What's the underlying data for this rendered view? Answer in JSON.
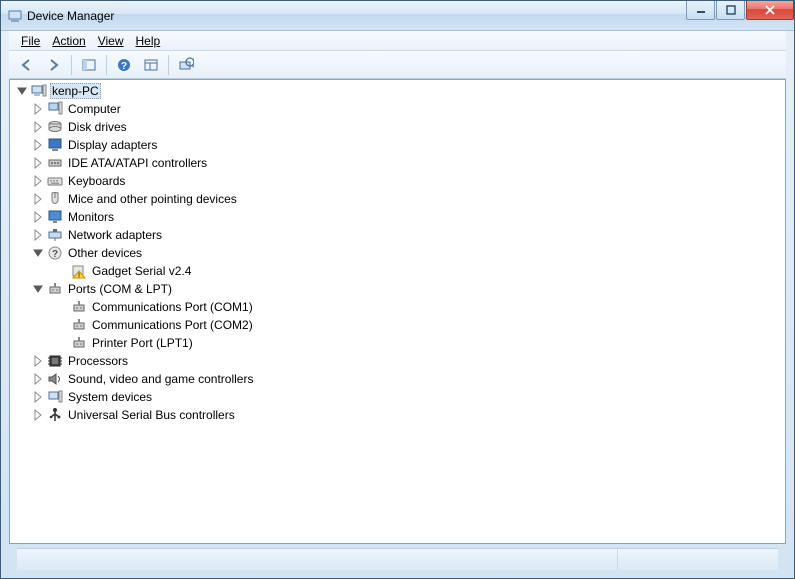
{
  "window": {
    "title": "Device Manager"
  },
  "menu": {
    "file": "File",
    "action": "Action",
    "view": "View",
    "help": "Help"
  },
  "root": {
    "label": "kenp-PC"
  },
  "categories": [
    {
      "key": "computer",
      "label": "Computer",
      "icon": "computer",
      "expanded": false
    },
    {
      "key": "disk",
      "label": "Disk drives",
      "icon": "disk",
      "expanded": false
    },
    {
      "key": "display",
      "label": "Display adapters",
      "icon": "display",
      "expanded": false
    },
    {
      "key": "ide",
      "label": "IDE ATA/ATAPI controllers",
      "icon": "ide",
      "expanded": false
    },
    {
      "key": "keyboards",
      "label": "Keyboards",
      "icon": "keyboard",
      "expanded": false
    },
    {
      "key": "mice",
      "label": "Mice and other pointing devices",
      "icon": "mouse",
      "expanded": false
    },
    {
      "key": "monitors",
      "label": "Monitors",
      "icon": "monitor",
      "expanded": false
    },
    {
      "key": "network",
      "label": "Network adapters",
      "icon": "network",
      "expanded": false
    },
    {
      "key": "other",
      "label": "Other devices",
      "icon": "other",
      "expanded": true,
      "children": [
        {
          "label": "Gadget Serial v2.4",
          "icon": "warning"
        }
      ]
    },
    {
      "key": "ports",
      "label": "Ports (COM & LPT)",
      "icon": "port",
      "expanded": true,
      "children": [
        {
          "label": "Communications Port (COM1)",
          "icon": "port"
        },
        {
          "label": "Communications Port (COM2)",
          "icon": "port"
        },
        {
          "label": "Printer Port (LPT1)",
          "icon": "port"
        }
      ]
    },
    {
      "key": "processors",
      "label": "Processors",
      "icon": "cpu",
      "expanded": false
    },
    {
      "key": "sound",
      "label": "Sound, video and game controllers",
      "icon": "sound",
      "expanded": false
    },
    {
      "key": "system",
      "label": "System devices",
      "icon": "system",
      "expanded": false
    },
    {
      "key": "usb",
      "label": "Universal Serial Bus controllers",
      "icon": "usb",
      "expanded": false
    }
  ]
}
